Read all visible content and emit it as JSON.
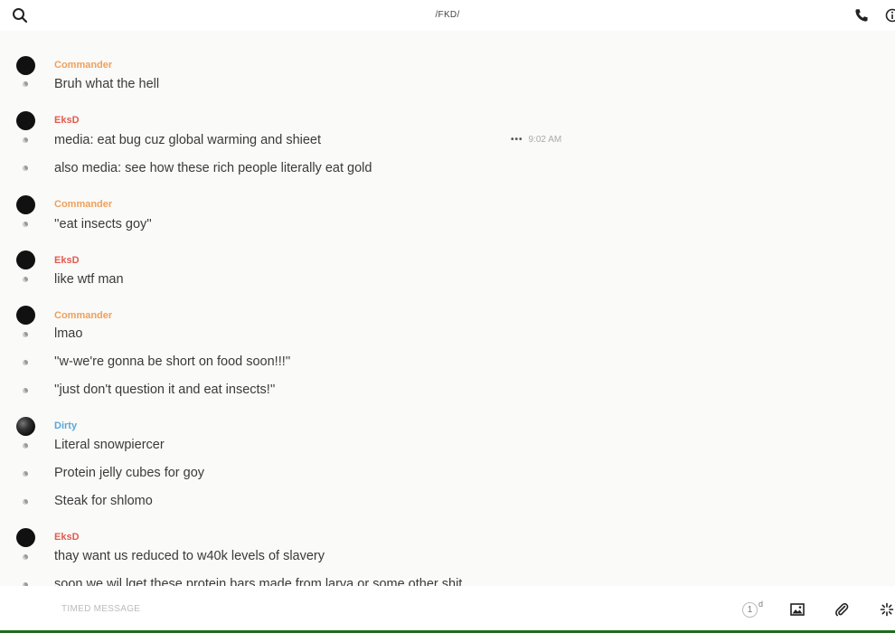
{
  "header": {
    "title": "/FKD/",
    "icons": {
      "search": "search-icon",
      "phone": "phone-icon",
      "info": "info-icon"
    }
  },
  "colors": {
    "commander": "#f0a05a",
    "eksd": "#e25b4e",
    "dirty": "#5ba7d6",
    "background": "#fafaf9"
  },
  "messages": [
    {
      "sender": "Commander",
      "lines": [
        "Bruh what the hell"
      ]
    },
    {
      "sender": "EksD",
      "lines": [
        "media: eat bug cuz global warming and shieet",
        "also media: see how these rich people literally eat gold"
      ],
      "hover_time": "9:02 AM",
      "hover_more": "•••"
    },
    {
      "sender": "Commander",
      "lines": [
        "''eat insects goy''"
      ]
    },
    {
      "sender": "EksD",
      "lines": [
        "like wtf man"
      ]
    },
    {
      "sender": "Commander",
      "lines": [
        "lmao",
        "''w-we're gonna be short on food soon!!!''",
        "''just don't question it and eat insects!''"
      ]
    },
    {
      "sender": "Dirty",
      "lines": [
        "Literal snowpiercer",
        "Protein jelly cubes for goy",
        "Steak for shlomo"
      ]
    },
    {
      "sender": "EksD",
      "lines": [
        "thay want us reduced to w40k levels of slavery",
        "soon we wil lget these protein bars made from larva or some other shit"
      ]
    }
  ],
  "composer": {
    "placeholder": "TIMED MESSAGE",
    "timer_value": "1",
    "timer_unit": "d",
    "icons": {
      "image": "image-icon",
      "attach": "paperclip-icon",
      "gif": "sparkle-icon"
    }
  }
}
